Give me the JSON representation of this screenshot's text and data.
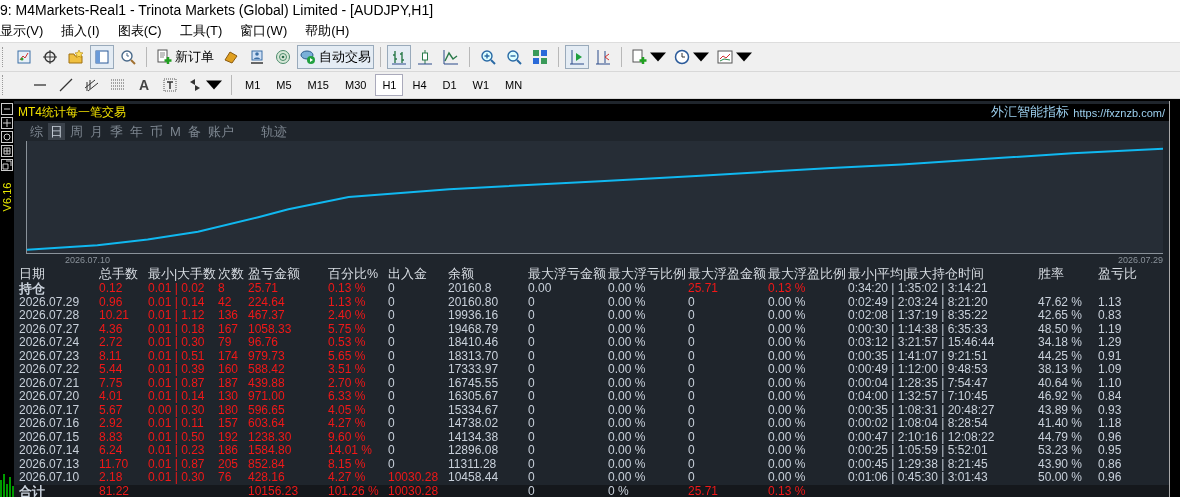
{
  "window": {
    "title": "9: M4Markets-Real1 - Trinota Markets (Global) Limited - [AUDJPY,H1]"
  },
  "menu": [
    "显示(V)",
    "插入(I)",
    "图表(C)",
    "工具(T)",
    "窗口(W)",
    "帮助(H)"
  ],
  "toolbar": {
    "new_order": "新订单",
    "auto_trading": "自动交易",
    "text_tool": "A"
  },
  "timeframes": [
    {
      "label": "M1",
      "selected": false
    },
    {
      "label": "M5",
      "selected": false
    },
    {
      "label": "M15",
      "selected": false
    },
    {
      "label": "M30",
      "selected": false
    },
    {
      "label": "H1",
      "selected": true
    },
    {
      "label": "H4",
      "selected": false
    },
    {
      "label": "D1",
      "selected": false
    },
    {
      "label": "W1",
      "selected": false
    },
    {
      "label": "MN",
      "selected": false
    }
  ],
  "indicator": {
    "version": "V6.16",
    "title": "MT4统计每一笔交易",
    "brand": "外汇智能指标",
    "url": "https://fxznzb.com/",
    "tabs": [
      {
        "label": "综",
        "selected": false
      },
      {
        "label": "日",
        "selected": true
      },
      {
        "label": "周",
        "selected": false
      },
      {
        "label": "月",
        "selected": false
      },
      {
        "label": "季",
        "selected": false
      },
      {
        "label": "年",
        "selected": false
      },
      {
        "label": "币",
        "selected": false
      },
      {
        "label": "M",
        "selected": false
      },
      {
        "label": "备",
        "selected": false
      },
      {
        "label": "账户",
        "selected": false
      },
      {
        "label": "轨迹",
        "selected": false
      }
    ],
    "chart": {
      "start_label": "2026.07.10",
      "end_label": "2026.07.29"
    },
    "table": {
      "columns": [
        "日期",
        "总手数",
        "最小|大手数",
        "次数",
        "盈亏金额",
        "百分比%",
        "出入金",
        "余额",
        "最大浮亏金额",
        "最大浮亏比例",
        "最大浮盈金额",
        "最大浮盈比例",
        "最小|平均|最大持仓时间",
        "胜率",
        "盈亏比"
      ],
      "rows": [
        {
          "date": {
            "text": "持仓",
            "color": "#c8d0da"
          },
          "lots": {
            "text": "0.12",
            "color": "#f01818"
          },
          "min_max_lots": {
            "text": "0.01 | 0.02",
            "color": "#f01818"
          },
          "trades": {
            "text": "8",
            "color": "#f01818"
          },
          "profit": {
            "text": "25.71",
            "color": "#f01818"
          },
          "percent": {
            "text": "0.13 %",
            "color": "#f01818"
          },
          "cash_flow": {
            "text": "0",
            "color": "#c8d0da"
          },
          "balance": {
            "text": "20160.8",
            "color": "#c8d0da"
          },
          "max_float_loss": {
            "text": "0.00",
            "color": "#c8d0da"
          },
          "max_float_loss_pct": {
            "text": "0.00 %",
            "color": "#c8d0da"
          },
          "max_float_profit": {
            "text": "25.71",
            "color": "#f01818"
          },
          "max_float_profit_pct": {
            "text": "0.13 %",
            "color": "#f01818"
          },
          "hold_times": {
            "text": "0:34:20 | 1:35:02 | 3:14:21",
            "color": "#c8d0da"
          }
        },
        {
          "date": {
            "text": "2026.07.29",
            "color": "#c8d0da"
          },
          "lots": {
            "text": "0.96",
            "color": "#f01818"
          },
          "min_max_lots": {
            "text": "0.01 | 0.14",
            "color": "#f01818"
          },
          "trades": {
            "text": "42",
            "color": "#f01818"
          },
          "profit": {
            "text": "224.64",
            "color": "#f01818"
          },
          "percent": {
            "text": "1.13 %",
            "color": "#f01818"
          },
          "cash_flow": {
            "text": "0",
            "color": "#c8d0da"
          },
          "balance": {
            "text": "20160.80",
            "color": "#c8d0da"
          },
          "max_float_loss": {
            "text": "0",
            "color": "#c8d0da"
          },
          "max_float_loss_pct": {
            "text": "0.00 %",
            "color": "#c8d0da"
          },
          "max_float_profit": {
            "text": "0",
            "color": "#c8d0da"
          },
          "max_float_profit_pct": {
            "text": "0.00 %",
            "color": "#c8d0da"
          },
          "hold_times": {
            "text": "0:02:49 | 2:03:24 | 8:21:20",
            "color": "#c8d0da"
          },
          "win_rate": {
            "text": "47.62 %",
            "color": "#c8d0da"
          },
          "profit_ratio": {
            "text": "1.13",
            "color": "#c8d0da"
          }
        },
        {
          "date": {
            "text": "2026.07.28",
            "color": "#c8d0da"
          },
          "lots": {
            "text": "10.21",
            "color": "#f01818"
          },
          "min_max_lots": {
            "text": "0.01 | 1.12",
            "color": "#f01818"
          },
          "trades": {
            "text": "136",
            "color": "#f01818"
          },
          "profit": {
            "text": "467.37",
            "color": "#f01818"
          },
          "percent": {
            "text": "2.40 %",
            "color": "#f01818"
          },
          "cash_flow": {
            "text": "0",
            "color": "#c8d0da"
          },
          "balance": {
            "text": "19936.16",
            "color": "#c8d0da"
          },
          "max_float_loss": {
            "text": "0",
            "color": "#c8d0da"
          },
          "max_float_loss_pct": {
            "text": "0.00 %",
            "color": "#c8d0da"
          },
          "max_float_profit": {
            "text": "0",
            "color": "#c8d0da"
          },
          "max_float_profit_pct": {
            "text": "0.00 %",
            "color": "#c8d0da"
          },
          "hold_times": {
            "text": "0:02:08 | 1:37:19 | 8:35:22",
            "color": "#c8d0da"
          },
          "win_rate": {
            "text": "42.65 %",
            "color": "#c8d0da"
          },
          "profit_ratio": {
            "text": "0.83",
            "color": "#c8d0da"
          }
        },
        {
          "date": {
            "text": "2026.07.27",
            "color": "#c8d0da"
          },
          "lots": {
            "text": "4.36",
            "color": "#f01818"
          },
          "min_max_lots": {
            "text": "0.01 | 0.18",
            "color": "#f01818"
          },
          "trades": {
            "text": "167",
            "color": "#f01818"
          },
          "profit": {
            "text": "1058.33",
            "color": "#f01818"
          },
          "percent": {
            "text": "5.75 %",
            "color": "#f01818"
          },
          "cash_flow": {
            "text": "0",
            "color": "#c8d0da"
          },
          "balance": {
            "text": "19468.79",
            "color": "#c8d0da"
          },
          "max_float_loss": {
            "text": "0",
            "color": "#c8d0da"
          },
          "max_float_loss_pct": {
            "text": "0.00 %",
            "color": "#c8d0da"
          },
          "max_float_profit": {
            "text": "0",
            "color": "#c8d0da"
          },
          "max_float_profit_pct": {
            "text": "0.00 %",
            "color": "#c8d0da"
          },
          "hold_times": {
            "text": "0:00:30 | 1:14:38 | 6:35:33",
            "color": "#c8d0da"
          },
          "win_rate": {
            "text": "48.50 %",
            "color": "#c8d0da"
          },
          "profit_ratio": {
            "text": "1.19",
            "color": "#c8d0da"
          }
        },
        {
          "date": {
            "text": "2026.07.24",
            "color": "#c8d0da"
          },
          "lots": {
            "text": "2.72",
            "color": "#f01818"
          },
          "min_max_lots": {
            "text": "0.01 | 0.30",
            "color": "#f01818"
          },
          "trades": {
            "text": "79",
            "color": "#f01818"
          },
          "profit": {
            "text": "96.76",
            "color": "#f01818"
          },
          "percent": {
            "text": "0.53 %",
            "color": "#f01818"
          },
          "cash_flow": {
            "text": "0",
            "color": "#c8d0da"
          },
          "balance": {
            "text": "18410.46",
            "color": "#c8d0da"
          },
          "max_float_loss": {
            "text": "0",
            "color": "#c8d0da"
          },
          "max_float_loss_pct": {
            "text": "0.00 %",
            "color": "#c8d0da"
          },
          "max_float_profit": {
            "text": "0",
            "color": "#c8d0da"
          },
          "max_float_profit_pct": {
            "text": "0.00 %",
            "color": "#c8d0da"
          },
          "hold_times": {
            "text": "0:03:12 | 3:21:57 | 15:46:44",
            "color": "#c8d0da"
          },
          "win_rate": {
            "text": "34.18 %",
            "color": "#c8d0da"
          },
          "profit_ratio": {
            "text": "1.29",
            "color": "#c8d0da"
          }
        },
        {
          "date": {
            "text": "2026.07.23",
            "color": "#c8d0da"
          },
          "lots": {
            "text": "8.11",
            "color": "#f01818"
          },
          "min_max_lots": {
            "text": "0.01 | 0.51",
            "color": "#f01818"
          },
          "trades": {
            "text": "174",
            "color": "#f01818"
          },
          "profit": {
            "text": "979.73",
            "color": "#f01818"
          },
          "percent": {
            "text": "5.65 %",
            "color": "#f01818"
          },
          "cash_flow": {
            "text": "0",
            "color": "#c8d0da"
          },
          "balance": {
            "text": "18313.70",
            "color": "#c8d0da"
          },
          "max_float_loss": {
            "text": "0",
            "color": "#c8d0da"
          },
          "max_float_loss_pct": {
            "text": "0.00 %",
            "color": "#c8d0da"
          },
          "max_float_profit": {
            "text": "0",
            "color": "#c8d0da"
          },
          "max_float_profit_pct": {
            "text": "0.00 %",
            "color": "#c8d0da"
          },
          "hold_times": {
            "text": "0:00:35 | 1:41:07 | 9:21:51",
            "color": "#c8d0da"
          },
          "win_rate": {
            "text": "44.25 %",
            "color": "#c8d0da"
          },
          "profit_ratio": {
            "text": "0.91",
            "color": "#c8d0da"
          }
        },
        {
          "date": {
            "text": "2026.07.22",
            "color": "#c8d0da"
          },
          "lots": {
            "text": "5.44",
            "color": "#f01818"
          },
          "min_max_lots": {
            "text": "0.01 | 0.39",
            "color": "#f01818"
          },
          "trades": {
            "text": "160",
            "color": "#f01818"
          },
          "profit": {
            "text": "588.42",
            "color": "#f01818"
          },
          "percent": {
            "text": "3.51 %",
            "color": "#f01818"
          },
          "cash_flow": {
            "text": "0",
            "color": "#c8d0da"
          },
          "balance": {
            "text": "17333.97",
            "color": "#c8d0da"
          },
          "max_float_loss": {
            "text": "0",
            "color": "#c8d0da"
          },
          "max_float_loss_pct": {
            "text": "0.00 %",
            "color": "#c8d0da"
          },
          "max_float_profit": {
            "text": "0",
            "color": "#c8d0da"
          },
          "max_float_profit_pct": {
            "text": "0.00 %",
            "color": "#c8d0da"
          },
          "hold_times": {
            "text": "0:00:49 | 1:12:00 | 9:48:53",
            "color": "#c8d0da"
          },
          "win_rate": {
            "text": "38.13 %",
            "color": "#c8d0da"
          },
          "profit_ratio": {
            "text": "1.09",
            "color": "#c8d0da"
          }
        },
        {
          "date": {
            "text": "2026.07.21",
            "color": "#c8d0da"
          },
          "lots": {
            "text": "7.75",
            "color": "#f01818"
          },
          "min_max_lots": {
            "text": "0.01 | 0.87",
            "color": "#f01818"
          },
          "trades": {
            "text": "187",
            "color": "#f01818"
          },
          "profit": {
            "text": "439.88",
            "color": "#f01818"
          },
          "percent": {
            "text": "2.70 %",
            "color": "#f01818"
          },
          "cash_flow": {
            "text": "0",
            "color": "#c8d0da"
          },
          "balance": {
            "text": "16745.55",
            "color": "#c8d0da"
          },
          "max_float_loss": {
            "text": "0",
            "color": "#c8d0da"
          },
          "max_float_loss_pct": {
            "text": "0.00 %",
            "color": "#c8d0da"
          },
          "max_float_profit": {
            "text": "0",
            "color": "#c8d0da"
          },
          "max_float_profit_pct": {
            "text": "0.00 %",
            "color": "#c8d0da"
          },
          "hold_times": {
            "text": "0:00:04 | 1:28:35 | 7:54:47",
            "color": "#c8d0da"
          },
          "win_rate": {
            "text": "40.64 %",
            "color": "#c8d0da"
          },
          "profit_ratio": {
            "text": "1.10",
            "color": "#c8d0da"
          }
        },
        {
          "date": {
            "text": "2026.07.20",
            "color": "#c8d0da"
          },
          "lots": {
            "text": "4.01",
            "color": "#f01818"
          },
          "min_max_lots": {
            "text": "0.01 | 0.14",
            "color": "#f01818"
          },
          "trades": {
            "text": "130",
            "color": "#f01818"
          },
          "profit": {
            "text": "971.00",
            "color": "#f01818"
          },
          "percent": {
            "text": "6.33 %",
            "color": "#f01818"
          },
          "cash_flow": {
            "text": "0",
            "color": "#c8d0da"
          },
          "balance": {
            "text": "16305.67",
            "color": "#c8d0da"
          },
          "max_float_loss": {
            "text": "0",
            "color": "#c8d0da"
          },
          "max_float_loss_pct": {
            "text": "0.00 %",
            "color": "#c8d0da"
          },
          "max_float_profit": {
            "text": "0",
            "color": "#c8d0da"
          },
          "max_float_profit_pct": {
            "text": "0.00 %",
            "color": "#c8d0da"
          },
          "hold_times": {
            "text": "0:04:00 | 1:32:57 | 7:10:45",
            "color": "#c8d0da"
          },
          "win_rate": {
            "text": "46.92 %",
            "color": "#c8d0da"
          },
          "profit_ratio": {
            "text": "0.84",
            "color": "#c8d0da"
          }
        },
        {
          "date": {
            "text": "2026.07.17",
            "color": "#c8d0da"
          },
          "lots": {
            "text": "5.67",
            "color": "#f01818"
          },
          "min_max_lots": {
            "text": "0.00 | 0.30",
            "color": "#f01818"
          },
          "trades": {
            "text": "180",
            "color": "#f01818"
          },
          "profit": {
            "text": "596.65",
            "color": "#f01818"
          },
          "percent": {
            "text": "4.05 %",
            "color": "#f01818"
          },
          "cash_flow": {
            "text": "0",
            "color": "#c8d0da"
          },
          "balance": {
            "text": "15334.67",
            "color": "#c8d0da"
          },
          "max_float_loss": {
            "text": "0",
            "color": "#c8d0da"
          },
          "max_float_loss_pct": {
            "text": "0.00 %",
            "color": "#c8d0da"
          },
          "max_float_profit": {
            "text": "0",
            "color": "#c8d0da"
          },
          "max_float_profit_pct": {
            "text": "0.00 %",
            "color": "#c8d0da"
          },
          "hold_times": {
            "text": "0:00:35 | 1:08:31 | 20:48:27",
            "color": "#c8d0da"
          },
          "win_rate": {
            "text": "43.89 %",
            "color": "#c8d0da"
          },
          "profit_ratio": {
            "text": "0.93",
            "color": "#c8d0da"
          }
        },
        {
          "date": {
            "text": "2026.07.16",
            "color": "#c8d0da"
          },
          "lots": {
            "text": "2.92",
            "color": "#f01818"
          },
          "min_max_lots": {
            "text": "0.01 | 0.11",
            "color": "#f01818"
          },
          "trades": {
            "text": "157",
            "color": "#f01818"
          },
          "profit": {
            "text": "603.64",
            "color": "#f01818"
          },
          "percent": {
            "text": "4.27 %",
            "color": "#f01818"
          },
          "cash_flow": {
            "text": "0",
            "color": "#c8d0da"
          },
          "balance": {
            "text": "14738.02",
            "color": "#c8d0da"
          },
          "max_float_loss": {
            "text": "0",
            "color": "#c8d0da"
          },
          "max_float_loss_pct": {
            "text": "0.00 %",
            "color": "#c8d0da"
          },
          "max_float_profit": {
            "text": "0",
            "color": "#c8d0da"
          },
          "max_float_profit_pct": {
            "text": "0.00 %",
            "color": "#c8d0da"
          },
          "hold_times": {
            "text": "0:00:02 | 1:08:04 | 8:28:54",
            "color": "#c8d0da"
          },
          "win_rate": {
            "text": "41.40 %",
            "color": "#c8d0da"
          },
          "profit_ratio": {
            "text": "1.18",
            "color": "#c8d0da"
          }
        },
        {
          "date": {
            "text": "2026.07.15",
            "color": "#c8d0da"
          },
          "lots": {
            "text": "8.83",
            "color": "#f01818"
          },
          "min_max_lots": {
            "text": "0.01 | 0.50",
            "color": "#f01818"
          },
          "trades": {
            "text": "192",
            "color": "#f01818"
          },
          "profit": {
            "text": "1238.30",
            "color": "#f01818"
          },
          "percent": {
            "text": "9.60 %",
            "color": "#f01818"
          },
          "cash_flow": {
            "text": "0",
            "color": "#c8d0da"
          },
          "balance": {
            "text": "14134.38",
            "color": "#c8d0da"
          },
          "max_float_loss": {
            "text": "0",
            "color": "#c8d0da"
          },
          "max_float_loss_pct": {
            "text": "0.00 %",
            "color": "#c8d0da"
          },
          "max_float_profit": {
            "text": "0",
            "color": "#c8d0da"
          },
          "max_float_profit_pct": {
            "text": "0.00 %",
            "color": "#c8d0da"
          },
          "hold_times": {
            "text": "0:00:47 | 2:10:16 | 12:08:22",
            "color": "#c8d0da"
          },
          "win_rate": {
            "text": "44.79 %",
            "color": "#c8d0da"
          },
          "profit_ratio": {
            "text": "0.96",
            "color": "#c8d0da"
          }
        },
        {
          "date": {
            "text": "2026.07.14",
            "color": "#c8d0da"
          },
          "lots": {
            "text": "6.24",
            "color": "#f01818"
          },
          "min_max_lots": {
            "text": "0.01 | 0.23",
            "color": "#f01818"
          },
          "trades": {
            "text": "186",
            "color": "#f01818"
          },
          "profit": {
            "text": "1584.80",
            "color": "#f01818"
          },
          "percent": {
            "text": "14.01 %",
            "color": "#f01818"
          },
          "cash_flow": {
            "text": "0",
            "color": "#c8d0da"
          },
          "balance": {
            "text": "12896.08",
            "color": "#c8d0da"
          },
          "max_float_loss": {
            "text": "0",
            "color": "#c8d0da"
          },
          "max_float_loss_pct": {
            "text": "0.00 %",
            "color": "#c8d0da"
          },
          "max_float_profit": {
            "text": "0",
            "color": "#c8d0da"
          },
          "max_float_profit_pct": {
            "text": "0.00 %",
            "color": "#c8d0da"
          },
          "hold_times": {
            "text": "0:00:25 | 1:05:59 | 5:52:01",
            "color": "#c8d0da"
          },
          "win_rate": {
            "text": "53.23 %",
            "color": "#c8d0da"
          },
          "profit_ratio": {
            "text": "0.95",
            "color": "#c8d0da"
          }
        },
        {
          "date": {
            "text": "2026.07.13",
            "color": "#c8d0da"
          },
          "lots": {
            "text": "11.70",
            "color": "#f01818"
          },
          "min_max_lots": {
            "text": "0.01 | 0.87",
            "color": "#f01818"
          },
          "trades": {
            "text": "205",
            "color": "#f01818"
          },
          "profit": {
            "text": "852.84",
            "color": "#f01818"
          },
          "percent": {
            "text": "8.15 %",
            "color": "#f01818"
          },
          "cash_flow": {
            "text": "0",
            "color": "#c8d0da"
          },
          "balance": {
            "text": "11311.28",
            "color": "#c8d0da"
          },
          "max_float_loss": {
            "text": "0",
            "color": "#c8d0da"
          },
          "max_float_loss_pct": {
            "text": "0.00 %",
            "color": "#c8d0da"
          },
          "max_float_profit": {
            "text": "0",
            "color": "#c8d0da"
          },
          "max_float_profit_pct": {
            "text": "0.00 %",
            "color": "#c8d0da"
          },
          "hold_times": {
            "text": "0:00:45 | 1:29:38 | 8:21:45",
            "color": "#c8d0da"
          },
          "win_rate": {
            "text": "43.90 %",
            "color": "#c8d0da"
          },
          "profit_ratio": {
            "text": "0.86",
            "color": "#c8d0da"
          }
        },
        {
          "date": {
            "text": "2026.07.10",
            "color": "#c8d0da"
          },
          "lots": {
            "text": "2.18",
            "color": "#f01818"
          },
          "min_max_lots": {
            "text": "0.01 | 0.30",
            "color": "#f01818"
          },
          "trades": {
            "text": "76",
            "color": "#f01818"
          },
          "profit": {
            "text": "428.16",
            "color": "#f01818"
          },
          "percent": {
            "text": "4.27 %",
            "color": "#f01818"
          },
          "cash_flow": {
            "text": "10030.28",
            "color": "#f01818"
          },
          "balance": {
            "text": "10458.44",
            "color": "#c8d0da"
          },
          "max_float_loss": {
            "text": "0",
            "color": "#c8d0da"
          },
          "max_float_loss_pct": {
            "text": "0.00 %",
            "color": "#c8d0da"
          },
          "max_float_profit": {
            "text": "0",
            "color": "#c8d0da"
          },
          "max_float_profit_pct": {
            "text": "0.00 %",
            "color": "#c8d0da"
          },
          "hold_times": {
            "text": "0:01:06 | 0:45:30 | 3:01:43",
            "color": "#c8d0da"
          },
          "win_rate": {
            "text": "50.00 %",
            "color": "#c8d0da"
          },
          "profit_ratio": {
            "text": "0.96",
            "color": "#c8d0da"
          }
        }
      ],
      "total": {
        "date": {
          "text": "合计",
          "color": "#c8d0da"
        },
        "lots": {
          "text": "81.22",
          "color": "#f01818"
        },
        "profit": {
          "text": "10156.23",
          "color": "#f01818"
        },
        "percent": {
          "text": "101.26 %",
          "color": "#f01818"
        },
        "cash_flow": {
          "text": "10030.28",
          "color": "#f01818"
        },
        "max_float_loss": {
          "text": "0",
          "color": "#c8d0da"
        },
        "max_float_loss_pct": {
          "text": "0 %",
          "color": "#c8d0da"
        },
        "max_float_profit": {
          "text": "25.71",
          "color": "#f01818"
        },
        "max_float_profit_pct": {
          "text": "0.13 %",
          "color": "#f01818"
        }
      }
    }
  }
}
